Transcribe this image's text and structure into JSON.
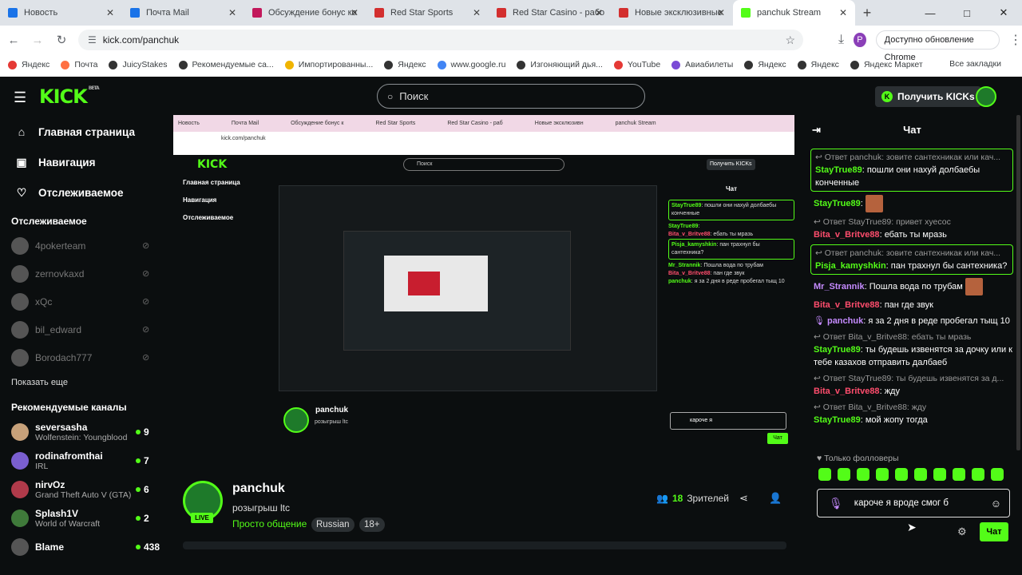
{
  "browser": {
    "tabs": [
      {
        "label": "Новость",
        "color": "#1a73e8"
      },
      {
        "label": "Почта Mail",
        "color": "#1a73e8"
      },
      {
        "label": "Обсуждение бонус ко",
        "color": "#c2185b"
      },
      {
        "label": "Red Star Sports",
        "color": "#d32f2f"
      },
      {
        "label": "Red Star Casino - рабо",
        "color": "#d32f2f"
      },
      {
        "label": "Новые эксклюзивные",
        "color": "#d32f2f"
      },
      {
        "label": "panchuk Stream",
        "color": "#53fc18"
      }
    ],
    "url": "kick.com/panchuk",
    "update_text": "Доступно обновление Chrome",
    "profile_letter": "P",
    "bookmarks": [
      "Яндекс",
      "Почта",
      "JuicyStakes",
      "Рекомендуемые са...",
      "Импортированны...",
      "Яндекс",
      "www.google.ru",
      "Изгоняющий дья...",
      "YouTube",
      "Авиабилеты",
      "Яндекс",
      "Яндекс",
      "Яндекс Маркет"
    ],
    "all_bookmarks": "Все закладки"
  },
  "header": {
    "logo": "KICK",
    "logo_beta": "BETA",
    "search_placeholder": "Поиск",
    "get_kicks": "Получить KICKs"
  },
  "sidebar": {
    "nav": [
      {
        "label": "Главная страница",
        "icon": "home-icon"
      },
      {
        "label": "Навигация",
        "icon": "compass-icon"
      },
      {
        "label": "Отслеживаемое",
        "icon": "heart-icon"
      }
    ],
    "following_title": "Отслеживаемое",
    "following": [
      "4pokerteam",
      "zernovkaxd",
      "xQc",
      "bil_edward",
      "Borodach777"
    ],
    "show_more": "Показать еще",
    "recommended_title": "Рекомендуемые каналы",
    "recommended": [
      {
        "name": "seversasha",
        "game": "Wolfenstein: Youngblood",
        "viewers": "9",
        "color": "#c7a17a"
      },
      {
        "name": "rodinafromthai",
        "game": "IRL",
        "viewers": "7",
        "color": "#7a5fd0"
      },
      {
        "name": "nirvOz",
        "game": "Grand Theft Auto V (GTA)",
        "viewers": "6",
        "color": "#b03a4a"
      },
      {
        "name": "Splash1V",
        "game": "World of Warcraft",
        "viewers": "2",
        "color": "#3f7a3a"
      },
      {
        "name": "Blame",
        "game": "",
        "viewers": "438",
        "color": "#555555"
      }
    ]
  },
  "stream": {
    "channel": "panchuk",
    "title": "розыгрыш ltc",
    "category": "Просто общение",
    "tags": [
      "Russian",
      "18+"
    ],
    "viewers_count": "18",
    "viewers_label": "Зрителей",
    "live": "LIVE"
  },
  "inner": {
    "tabs": [
      "Новость",
      "Почта Mail",
      "Обсуждение бонус к",
      "Red Star Sports",
      "Red Star Casino - раб",
      "Новые эксклюзивн",
      "panchuk Stream"
    ],
    "url": "kick.com/panchuk",
    "search": "Поиск",
    "kicks": "Получить KICKs",
    "nav": [
      "Главная страница",
      "Навигация",
      "Отслеживаемое"
    ],
    "chat_title": "Чат",
    "input": "кароче я",
    "chat_btn": "Чат",
    "followers": "Только фолловеры"
  },
  "chat": {
    "title": "Чат",
    "messages": [
      {
        "reply": "Ответ panchuk: зовите сантехникак или кач...",
        "user": "StayTrue89",
        "uc": "g",
        "text": "пошли они нахуй долбаебы конченные",
        "hl": true
      },
      {
        "reply": "",
        "user": "StayTrue89",
        "uc": "g",
        "text": "",
        "emote": true,
        "hl": false
      },
      {
        "reply": "Ответ StayTrue89: привет хуесос",
        "user": "Bita_v_Britve88",
        "uc": "r",
        "text": "ебать ты мразь",
        "hl": false
      },
      {
        "reply": "Ответ panchuk: зовите сантехникак или кач...",
        "user": "Pisja_kamyshkin",
        "uc": "g",
        "text": "пан трахнул бы сантехника?",
        "hl": true
      },
      {
        "reply": "",
        "user": "Mr_Strannik",
        "uc": "v",
        "text": "Пошла вода по трубам",
        "emote": true,
        "hl": false
      },
      {
        "reply": "",
        "user": "Bita_v_Britve88",
        "uc": "r",
        "text": "пан где звук",
        "hl": false
      },
      {
        "reply": "",
        "user": "panchuk",
        "uc": "v",
        "text": "я за 2 дня в реде пробегал тыщ 10",
        "mic": true,
        "hl": false
      },
      {
        "reply": "Ответ Bita_v_Britve88: ебать ты мразь",
        "user": "StayTrue89",
        "uc": "g",
        "text": "ты будешь извенятся за дочку или к тебе казахов отправить далбаеб",
        "hl": false
      },
      {
        "reply": "Ответ StayTrue89: ты будешь извенятся за д...",
        "user": "Bita_v_Britve88",
        "uc": "r",
        "text": "жду",
        "hl": false
      },
      {
        "reply": "Ответ Bita_v_Britve88: жду",
        "user": "StayTrue89",
        "uc": "g",
        "text": "мой жопу тогда",
        "hl": false
      }
    ],
    "followers_only": "Только фолловеры",
    "input_text": "кароче я вроде смог б",
    "send": "Чат"
  }
}
